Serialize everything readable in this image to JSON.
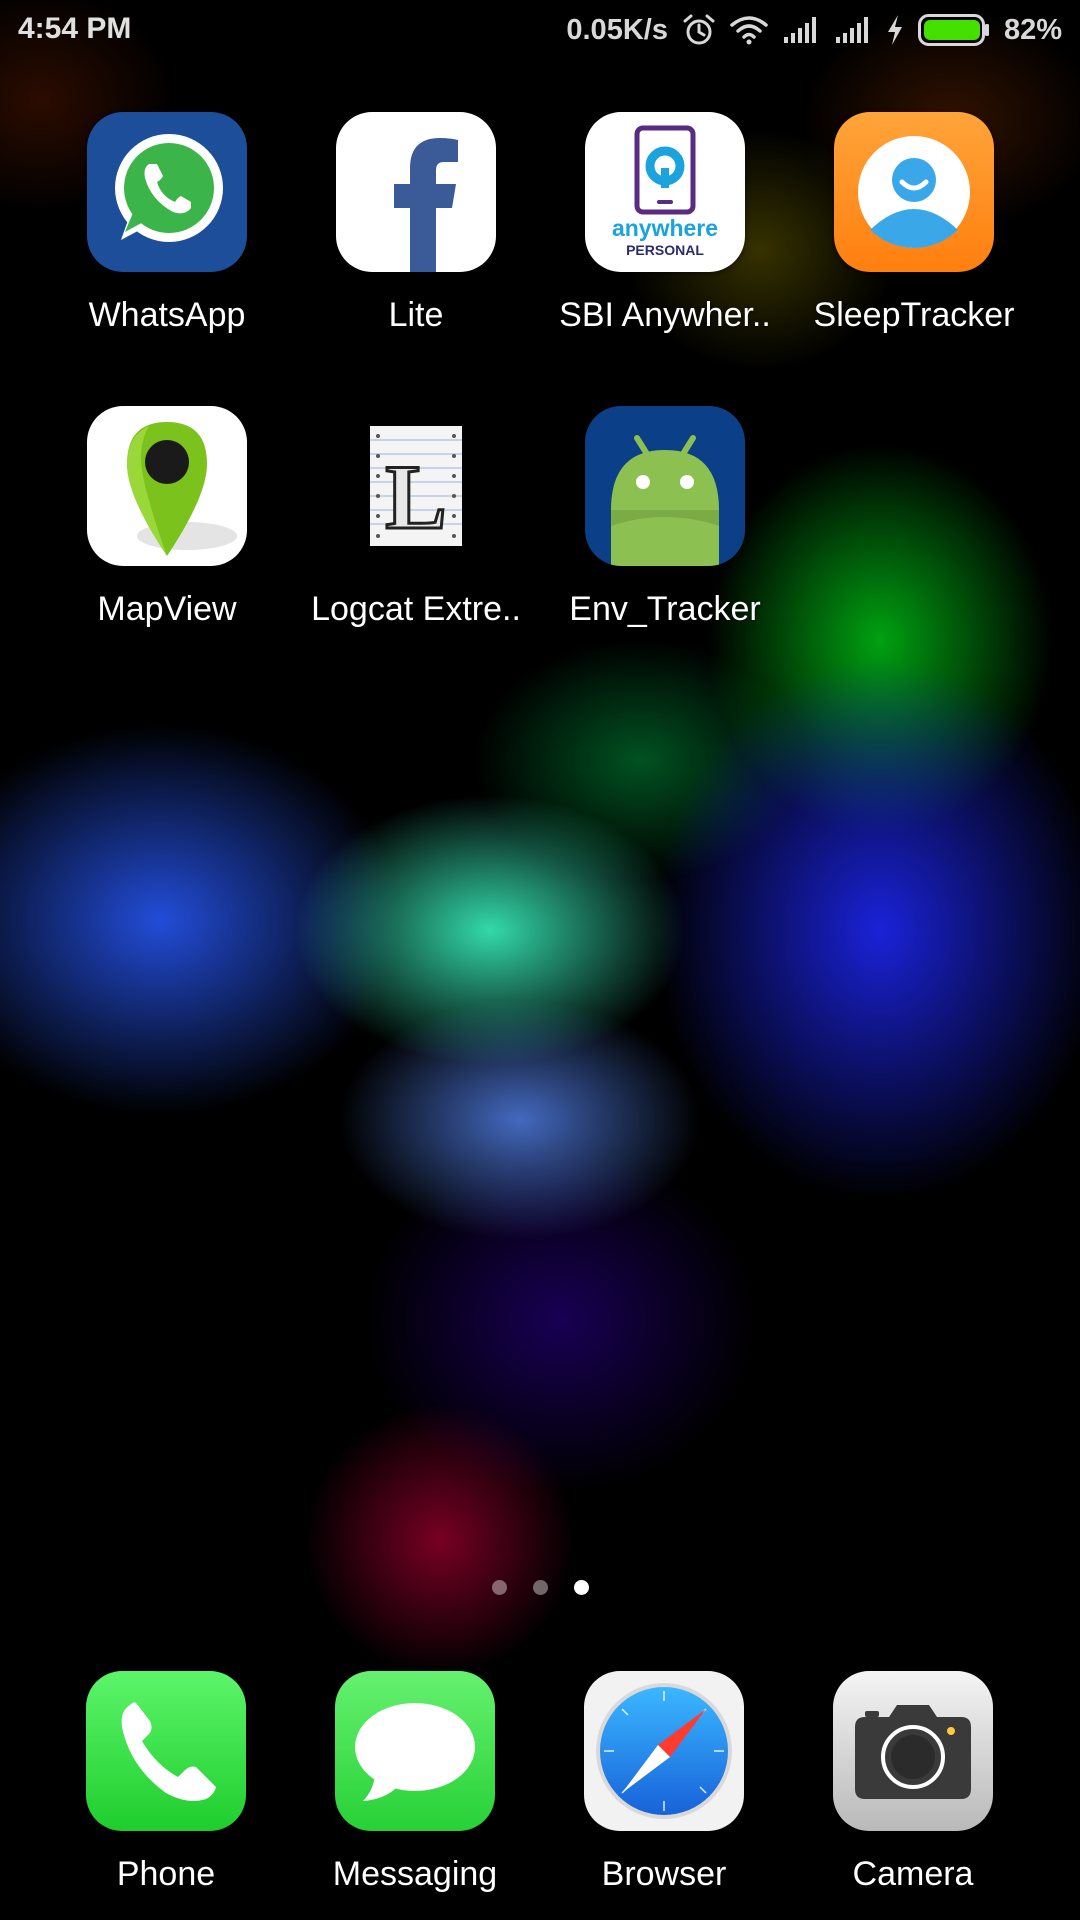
{
  "status_bar": {
    "time": "4:54 PM",
    "network_speed": "0.05K/s",
    "battery_percent": "82%",
    "battery_level": 0.82,
    "icons": [
      "alarm-icon",
      "wifi-icon",
      "signal-icon",
      "signal-icon",
      "charging-icon",
      "battery-icon"
    ]
  },
  "apps": [
    {
      "label": "WhatsApp",
      "icon": "whatsapp-icon"
    },
    {
      "label": "Lite",
      "icon": "facebook-lite-icon"
    },
    {
      "label": "SBI Anywher..",
      "icon": "sbi-anywhere-icon",
      "icon_text_top": "anywhere",
      "icon_text_bottom": "PERSONAL"
    },
    {
      "label": "SleepTracker",
      "icon": "sleeptracker-icon"
    },
    {
      "label": "MapView",
      "icon": "map-pin-icon"
    },
    {
      "label": "Logcat Extre..",
      "icon": "logcat-icon",
      "icon_letter": "L"
    },
    {
      "label": "Env_Tracker",
      "icon": "android-icon"
    }
  ],
  "page_indicator": {
    "total": 3,
    "active": 3
  },
  "dock": [
    {
      "label": "Phone",
      "icon": "phone-icon"
    },
    {
      "label": "Messaging",
      "icon": "messaging-icon"
    },
    {
      "label": "Browser",
      "icon": "compass-icon"
    },
    {
      "label": "Camera",
      "icon": "camera-icon"
    }
  ],
  "colors": {
    "whatsapp_bg": "#1c4e9a",
    "whatsapp_green": "#3bb54a",
    "facebook_blue": "#3b5a98",
    "sleeptracker_orange": "#ff8c1a",
    "mapview_green": "#7cc21c",
    "android_bg": "#0b3f88",
    "android_green": "#8cc152",
    "phone_green": "#2ed83a",
    "messaging_green": "#3fdc4c",
    "browser_blue": "#1e88e5"
  }
}
